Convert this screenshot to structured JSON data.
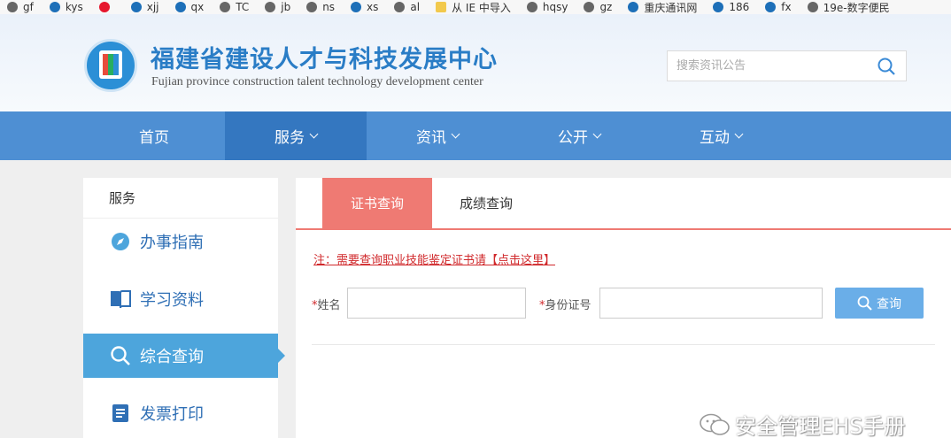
{
  "bookmarks": [
    {
      "label": "gf",
      "icon": "globe-icon"
    },
    {
      "label": "kys",
      "icon": "bookmark-icon"
    },
    {
      "label": "",
      "icon": "weibo-icon"
    },
    {
      "label": "xjj",
      "icon": "bookmark-icon"
    },
    {
      "label": "qx",
      "icon": "bookmark-icon"
    },
    {
      "label": "TC",
      "icon": "globe-icon"
    },
    {
      "label": "jb",
      "icon": "globe-icon"
    },
    {
      "label": "ns",
      "icon": "globe-icon"
    },
    {
      "label": "xs",
      "icon": "bookmark-icon"
    },
    {
      "label": "al",
      "icon": "globe-icon"
    },
    {
      "label": "从 IE 中导入",
      "icon": "folder-icon"
    },
    {
      "label": "hqsy",
      "icon": "globe-icon"
    },
    {
      "label": "gz",
      "icon": "globe-icon"
    },
    {
      "label": "重庆通讯网",
      "icon": "bookmark-icon"
    },
    {
      "label": "186",
      "icon": "bookmark-icon"
    },
    {
      "label": "fx",
      "icon": "bookmark-icon"
    },
    {
      "label": "19e-数字便民",
      "icon": "globe-icon"
    }
  ],
  "header": {
    "title": "福建省建设人才与科技发展中心",
    "subtitle": "Fujian province construction talent technology development center",
    "search_placeholder": "搜索资讯公告"
  },
  "nav": {
    "items": [
      {
        "label": "首页",
        "has_dropdown": false
      },
      {
        "label": "服务",
        "has_dropdown": true,
        "active": true
      },
      {
        "label": "资讯",
        "has_dropdown": true
      },
      {
        "label": "公开",
        "has_dropdown": true
      },
      {
        "label": "互动",
        "has_dropdown": true
      }
    ]
  },
  "sidebar": {
    "heading": "服务",
    "items": [
      {
        "label": "办事指南",
        "icon": "compass-icon"
      },
      {
        "label": "学习资料",
        "icon": "book-icon"
      },
      {
        "label": "综合查询",
        "icon": "search-icon",
        "active": true
      },
      {
        "label": "发票打印",
        "icon": "document-icon"
      }
    ]
  },
  "main": {
    "tabs": [
      {
        "label": "证书查询",
        "active": true
      },
      {
        "label": "成绩查询",
        "active": false
      }
    ],
    "note": "注：需要查询职业技能鉴定证书请【点击这里】",
    "fields": [
      {
        "label": "姓名",
        "required_mark": "*",
        "value": ""
      },
      {
        "label": "身份证号",
        "required_mark": "*",
        "value": ""
      }
    ],
    "query_button": "查询"
  },
  "watermark": {
    "text": "安全管理EHS手册"
  },
  "colors": {
    "nav_bg": "#4e8fd3",
    "nav_active": "#3477c0",
    "title_blue": "#2a7dc6",
    "tab_active": "#ef7a73",
    "sidebar_active": "#4da5dc",
    "button_blue": "#6aaee8",
    "note_red": "#d0282b"
  }
}
